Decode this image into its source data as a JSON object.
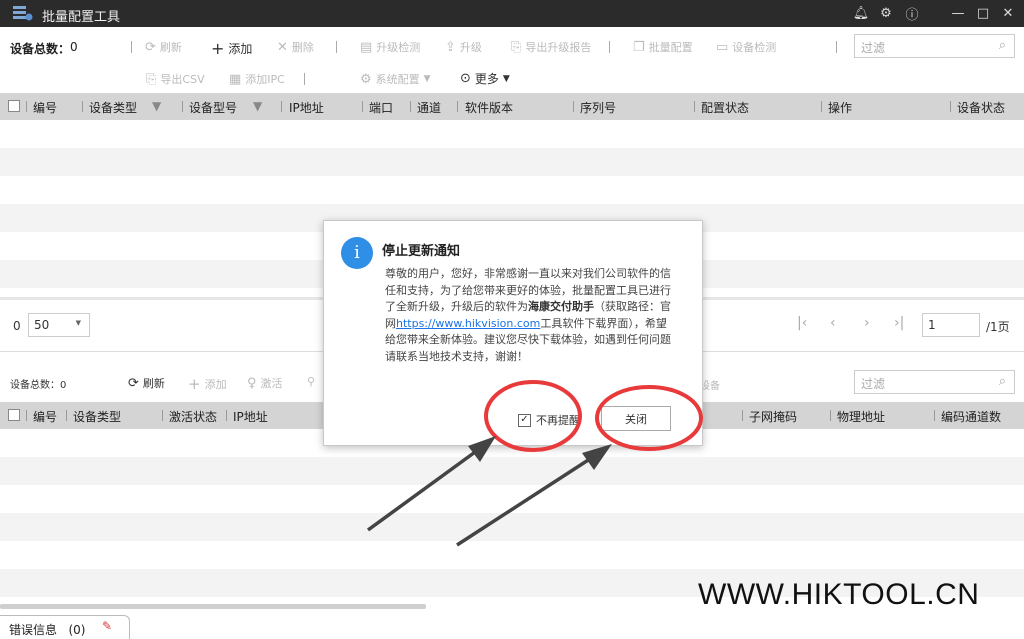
{
  "titlebar": {
    "title": "批量配置工具",
    "bell_icon": "bell-icon",
    "settings_icon": "gear-icon",
    "info_icon": "info-icon",
    "minimize": "—",
    "maximize": "□",
    "close": "✕"
  },
  "toolbar": {
    "device_total_label": "设备总数：",
    "device_total_value": "0",
    "refresh": "刷新",
    "add": "添加",
    "delete": "删除",
    "upgrade_check": "升级检测",
    "upgrade": "升级",
    "export_upgrade_report": "导出升级报告",
    "batch_config": "批量配置",
    "device_check": "设备检测",
    "export_csv": "导出CSV",
    "add_ipc": "添加IPC",
    "system_config": "系统配置",
    "more": "更多",
    "filter_placeholder": "过滤"
  },
  "table1": {
    "headers": [
      "编号",
      "设备类型",
      "设备型号",
      "IP地址",
      "端口",
      "通道",
      "软件版本",
      "序列号",
      "配置状态",
      "操作",
      "设备状态"
    ]
  },
  "pager": {
    "count": "0",
    "page_size": "50",
    "page_input": "1",
    "total_pages": "/1页"
  },
  "table2_toolbar": {
    "device_total": "设备总数：0",
    "refresh": "刷新",
    "add": "添加",
    "activate": "激活",
    "partial_device": "修设备",
    "filter_placeholder": "过滤"
  },
  "table2": {
    "headers": [
      "编号",
      "设备类型",
      "激活状态",
      "IP地址",
      "子网掩码",
      "物理地址",
      "编码通道数"
    ]
  },
  "dialog": {
    "title": "停止更新通知",
    "body_part1": "尊敬的用户，您好，非常感谢一直以来对我们公司软件的信任和支持，为了给您带来更好的体验，批量配置工具已进行了全新升级，升级后的软件为",
    "body_bold": "海康交付助手",
    "body_part2": "（获取路径：官网",
    "link": "https://www.hikvision.com",
    "body_part3": "工具软件下载界面），希望给您带来全新体验。建议您尽快下载体验，如遇到任何问题请联系当地技术支持，谢谢！",
    "dont_remind": "不再提醒",
    "close_button": "关闭"
  },
  "status": {
    "error_info": "错误信息",
    "error_count": "(0)"
  },
  "watermark": "WWW.HIKTOOL.CN",
  "colors": {
    "accent": "#2f8fe6",
    "annotation_red": "#e83a3a",
    "titlebar": "#2b2b2b",
    "header_gray": "#d4d4d4"
  }
}
